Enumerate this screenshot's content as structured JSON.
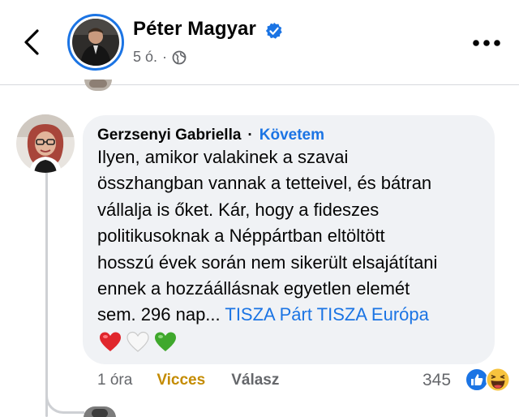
{
  "header": {
    "page_name": "Péter Magyar",
    "time": "5 ó.",
    "dot": "·",
    "verified": true,
    "back_icon": "back-arrow-icon",
    "more_icon": "more-horizontal-icon"
  },
  "comment": {
    "author": "Gerzsenyi Gabriella",
    "separator": "·",
    "follow_label": "Követem",
    "text": "Ilyen, amikor valakinek a szavai\nösszhangban vannak a tetteivel, és bátran\nvállalja is őket. Kár, hogy a fideszes\npolitikusoknak a Néppártban eltöltött\nhosszú évek során nem sikerült elsajátítani\nennek a hozzáállásnak egyetlen elemét\nsem. 296 nap... ",
    "tags": "TISZA Párt TISZA Európa",
    "emoji": [
      "red-heart",
      "white-heart",
      "green-heart"
    ]
  },
  "actions": {
    "time": "1 óra",
    "react_label": "Vicces",
    "reply_label": "Válasz",
    "reaction_count": "345",
    "reaction_icons": [
      "like-icon",
      "haha-icon"
    ]
  },
  "colors": {
    "accent_blue": "#1b74e4",
    "bubble_bg": "#f0f2f5",
    "react_gold": "#c48b00",
    "muted_text": "#65676b"
  }
}
